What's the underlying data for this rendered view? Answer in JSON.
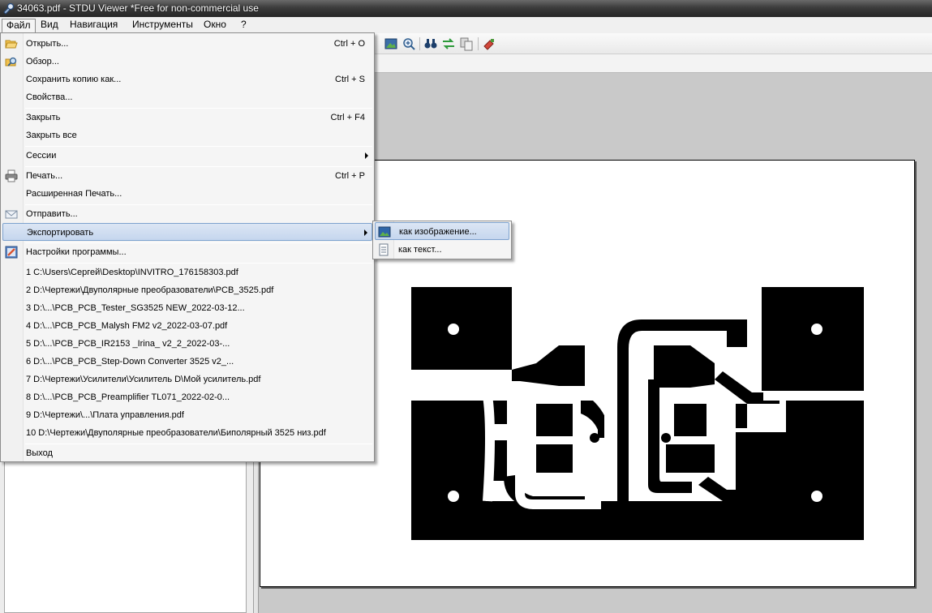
{
  "window": {
    "title": "34063.pdf - STDU Viewer *Free for non-commercial use"
  },
  "menubar": {
    "items": [
      "Файл",
      "Вид",
      "Навигация",
      "Инструменты",
      "Окно",
      "?"
    ]
  },
  "file_menu": {
    "items": [
      {
        "label": "Открыть...",
        "shortcut": "Ctrl + O",
        "icon": "folder-open-icon"
      },
      {
        "label": "Обзор...",
        "shortcut": "",
        "icon": "browse-icon"
      },
      {
        "label": "Сохранить копию как...",
        "shortcut": "Ctrl + S",
        "icon": ""
      },
      {
        "label": "Свойства...",
        "shortcut": "",
        "icon": ""
      },
      {
        "label": "Закрыть",
        "shortcut": "Ctrl + F4",
        "icon": ""
      },
      {
        "label": "Закрыть все",
        "shortcut": "",
        "icon": ""
      },
      {
        "label": "Сессии",
        "shortcut": "",
        "icon": ""
      },
      {
        "label": "Печать...",
        "shortcut": "Ctrl + P",
        "icon": "printer-icon"
      },
      {
        "label": "Расширенная Печать...",
        "shortcut": "",
        "icon": ""
      },
      {
        "label": "Отправить...",
        "shortcut": "",
        "icon": "envelope-icon"
      },
      {
        "label": "Экспортировать",
        "shortcut": "",
        "icon": ""
      },
      {
        "label": "Настройки программы...",
        "shortcut": "",
        "icon": "settings-icon"
      }
    ],
    "recent": [
      "1 C:\\Users\\Сергей\\Desktop\\INVITRO_176158303.pdf",
      "2 D:\\Чертежи\\Двуполярные преобразователи\\PCB_3525.pdf",
      "3 D:\\...\\PCB_PCB_Tester_SG3525 NEW_2022-03-12...",
      "4 D:\\...\\PCB_PCB_Malysh FM2 v2_2022-03-07.pdf",
      "5 D:\\...\\PCB_PCB_IR2153 _Irina_ v2_2_2022-03-...",
      "6 D:\\...\\PCB_PCB_Step-Down Converter 3525 v2_...",
      "7 D:\\Чертежи\\Усилители\\Усилитель D\\Мой усилитель.pdf",
      "8 D:\\...\\PCB_PCB_Preamplifier TL071_2022-02-0...",
      "9 D:\\Чертежи\\...\\Плата управления.pdf",
      "10 D:\\Чертежи\\Двуполярные преобразователи\\Биполярный 3525 низ.pdf"
    ],
    "exit": "Выход"
  },
  "export_submenu": {
    "items": [
      {
        "label": "как изображение...",
        "icon": "image-icon"
      },
      {
        "label": "как текст...",
        "icon": "text-document-icon"
      }
    ]
  },
  "colors": {
    "highlight": "#c5d6ee",
    "highlight_border": "#7da2ce",
    "menu_bg": "#f5f5f5",
    "pcb": "#000000"
  }
}
